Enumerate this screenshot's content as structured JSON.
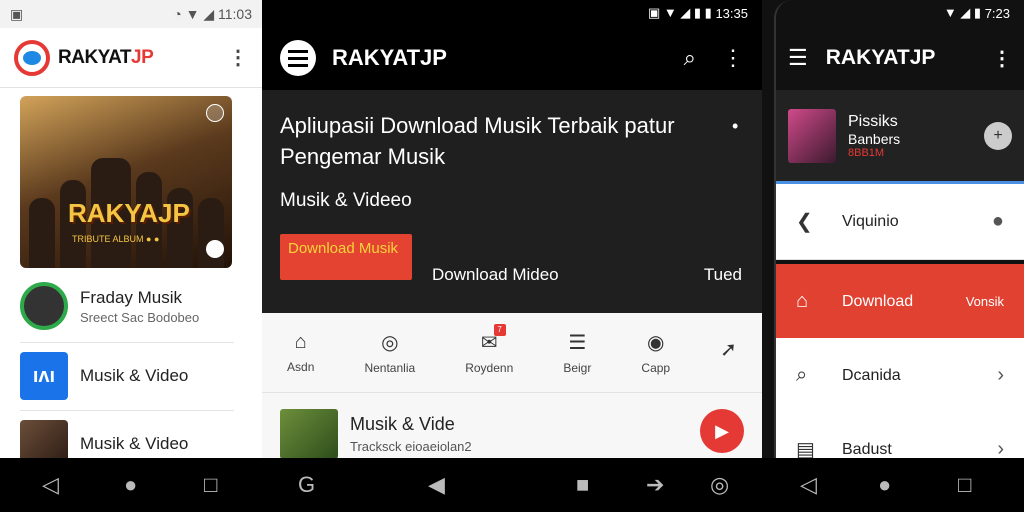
{
  "panel1": {
    "status_time": "11:03",
    "brand_prefix": "RAKYAT",
    "brand_suffix": "JP",
    "album_title": "RAKYAJP",
    "album_subtitle": "TRIBUTE ALBUM ●  ●",
    "items": [
      {
        "title": "Fraday Musik",
        "subtitle": "Sreect Sac Bodobeo"
      },
      {
        "title": "Musik & Video",
        "subtitle": ""
      },
      {
        "title": "Musik & Video",
        "subtitle": ""
      }
    ]
  },
  "panel2": {
    "status_time": "13:35",
    "brand": "RAKYATJP",
    "headline": "Apliupasii Download Musik Terbaik patur Pengemar Musik",
    "subhead": "Musik & Videeo",
    "download_button": "Download Musik",
    "download_video": "Download Mideo",
    "tued": "Tued",
    "nav": [
      {
        "label": "Asdn",
        "icon": "home-icon"
      },
      {
        "label": "Nentanlia",
        "icon": "music-icon"
      },
      {
        "label": "Roydenn",
        "icon": "chat-icon"
      },
      {
        "label": "Beigr",
        "icon": "list-icon"
      },
      {
        "label": "Capp",
        "icon": "camera-icon"
      },
      {
        "label": "",
        "icon": "share-icon"
      }
    ],
    "row": {
      "title": "Musik & Vide",
      "subtitle": "Tracksck eioaeiolan2"
    }
  },
  "panel3": {
    "status_time": "7:23",
    "brand": "RAKYATJP",
    "profile": {
      "name1": "Pissiks",
      "name2": "Banbers",
      "name3": "8BB1M"
    },
    "menu": [
      {
        "label": "Viquinio",
        "icon": "back-icon",
        "end": "person-icon",
        "active": false
      },
      {
        "label": "Download",
        "icon": "home-icon",
        "end": "Vonsik",
        "active": true
      },
      {
        "label": "Dcanida",
        "icon": "search-icon",
        "end": "chevron-right-icon",
        "active": false
      },
      {
        "label": "Badust",
        "icon": "clipboard-icon",
        "end": "chevron-right-icon",
        "active": false
      }
    ]
  },
  "colors": {
    "accent": "#e53935",
    "dark": "#1f1f1f",
    "highlight": "#4a90e2"
  }
}
